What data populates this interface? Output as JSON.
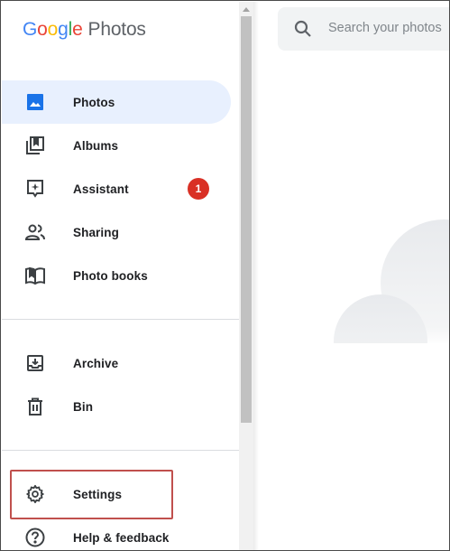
{
  "app": {
    "logo_google": [
      "G",
      "o",
      "o",
      "g",
      "l",
      "e"
    ],
    "logo_product": "Photos"
  },
  "sidebar": {
    "items": [
      {
        "label": "Photos",
        "icon": "photo-icon",
        "active": true
      },
      {
        "label": "Albums",
        "icon": "albums-icon"
      },
      {
        "label": "Assistant",
        "icon": "assistant-icon",
        "badge": "1"
      },
      {
        "label": "Sharing",
        "icon": "sharing-icon"
      },
      {
        "label": "Photo books",
        "icon": "photo-books-icon"
      },
      {
        "label": "Archive",
        "icon": "archive-icon"
      },
      {
        "label": "Bin",
        "icon": "bin-icon"
      },
      {
        "label": "Settings",
        "icon": "gear-icon",
        "highlighted": true
      },
      {
        "label": "Help & feedback",
        "icon": "help-icon"
      }
    ]
  },
  "search": {
    "placeholder": "Search your photos"
  },
  "colors": {
    "active_bg": "#e8f0fe",
    "active_icon": "#1a73e8",
    "badge": "#d93025",
    "highlight_border": "#c0504d"
  }
}
